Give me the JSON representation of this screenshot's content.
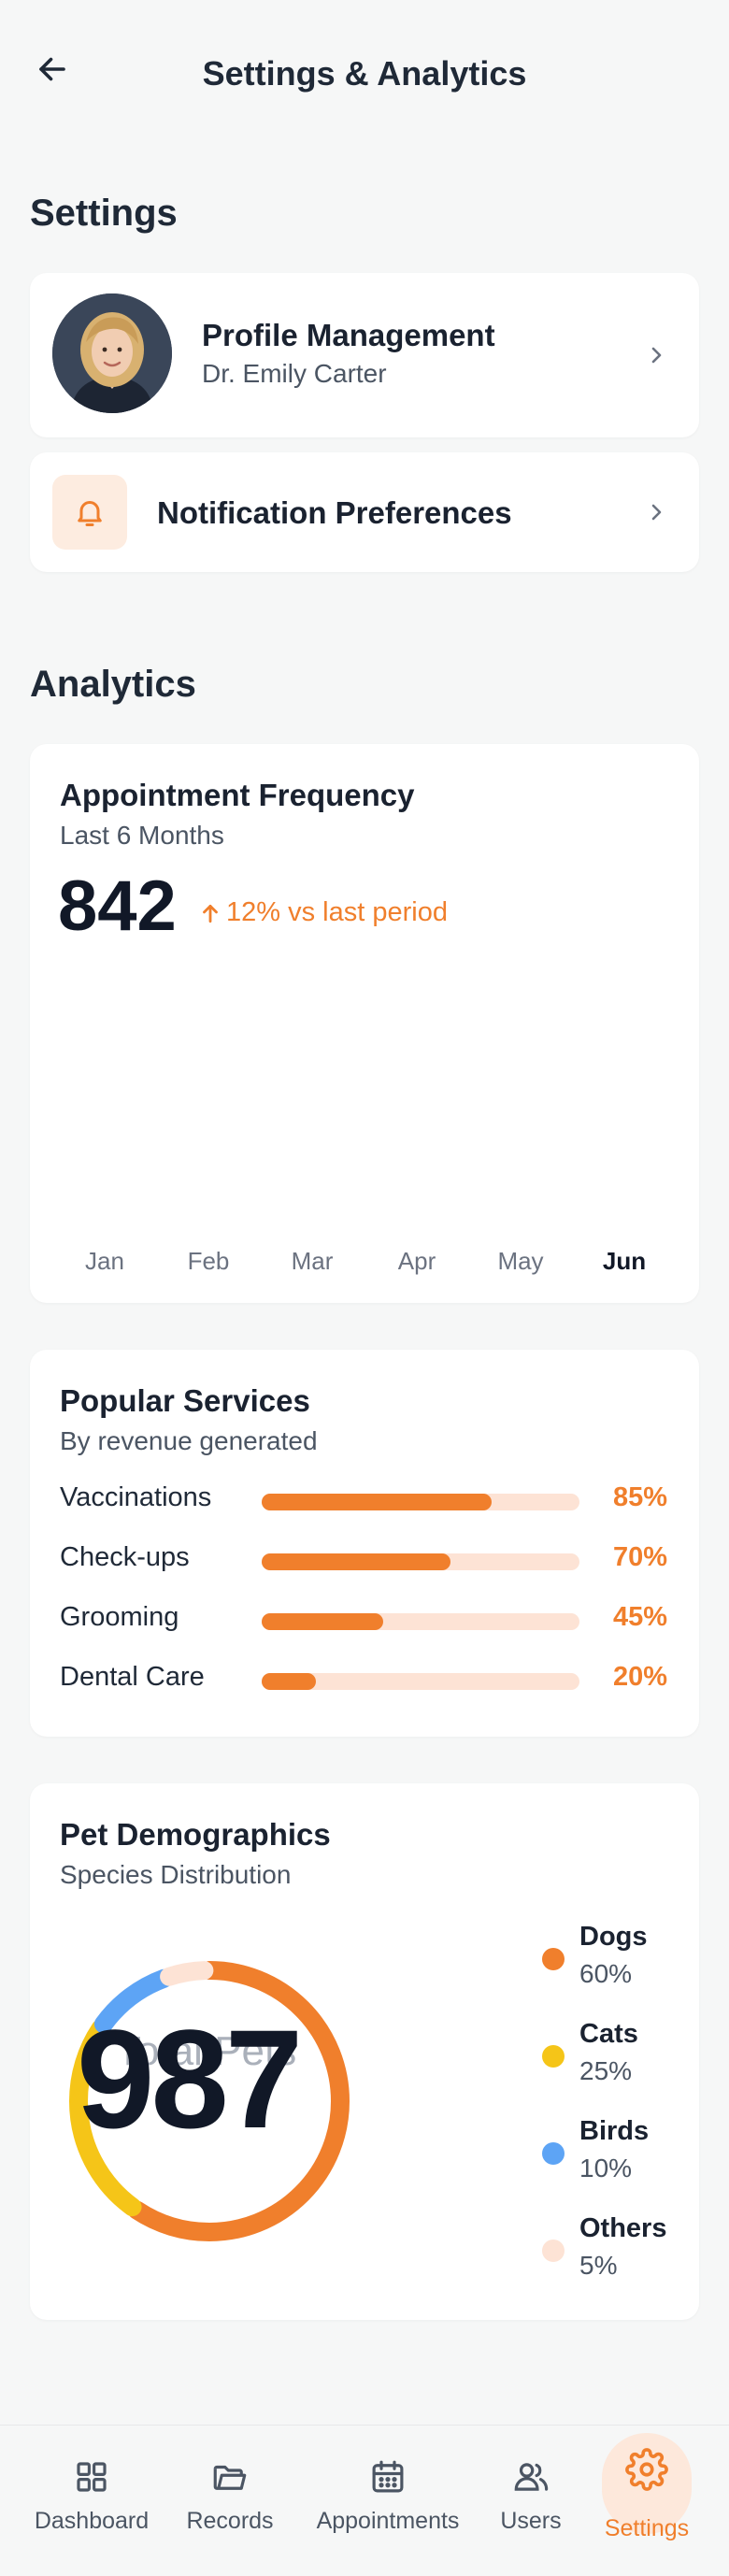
{
  "header": {
    "title": "Settings & Analytics"
  },
  "settings": {
    "section_title": "Settings",
    "profile": {
      "title": "Profile Management",
      "name": "Dr. Emily Carter"
    },
    "notifications": {
      "title": "Notification Preferences"
    }
  },
  "analytics": {
    "section_title": "Analytics",
    "appointments": {
      "title": "Appointment Frequency",
      "subtitle": "Last 6 Months",
      "total": "842",
      "trend": "12% vs last period",
      "months": [
        "Jan",
        "Feb",
        "Mar",
        "Apr",
        "May",
        "Jun"
      ],
      "active_month": "Jun"
    },
    "services": {
      "title": "Popular Services",
      "subtitle": "By revenue generated",
      "items": [
        {
          "label": "Vaccinations",
          "value": 85,
          "pct": "85%"
        },
        {
          "label": "Check-ups",
          "value": 70,
          "pct": "70%"
        },
        {
          "label": "Grooming",
          "value": 45,
          "pct": "45%"
        },
        {
          "label": "Dental Care",
          "value": 20,
          "pct": "20%"
        }
      ]
    },
    "demographics": {
      "title": "Pet Demographics",
      "subtitle": "Species Distribution",
      "center_label": "Total Pets",
      "center_value": "987",
      "chart_data": {
        "type": "pie",
        "categories": [
          "Dogs",
          "Cats",
          "Birds",
          "Others"
        ],
        "values": [
          60,
          25,
          10,
          5
        ],
        "colors": [
          "#f07f2c",
          "#f5c518",
          "#5da4f5",
          "#fde3d5"
        ]
      },
      "legend": [
        {
          "name": "Dogs",
          "value": "60%",
          "color": "#f07f2c"
        },
        {
          "name": "Cats",
          "value": "25%",
          "color": "#f5c518"
        },
        {
          "name": "Birds",
          "value": "10%",
          "color": "#5da4f5"
        },
        {
          "name": "Others",
          "value": "5%",
          "color": "#fde3d5"
        }
      ]
    }
  },
  "nav": {
    "items": [
      {
        "label": "Dashboard",
        "icon": "grid-icon"
      },
      {
        "label": "Records",
        "icon": "folder-icon"
      },
      {
        "label": "Appointments",
        "icon": "calendar-icon"
      },
      {
        "label": "Users",
        "icon": "users-icon"
      },
      {
        "label": "Settings",
        "icon": "gear-icon"
      }
    ],
    "active": "Settings"
  },
  "colors": {
    "accent": "#f07f2c",
    "accent_light": "#fde3d5"
  }
}
